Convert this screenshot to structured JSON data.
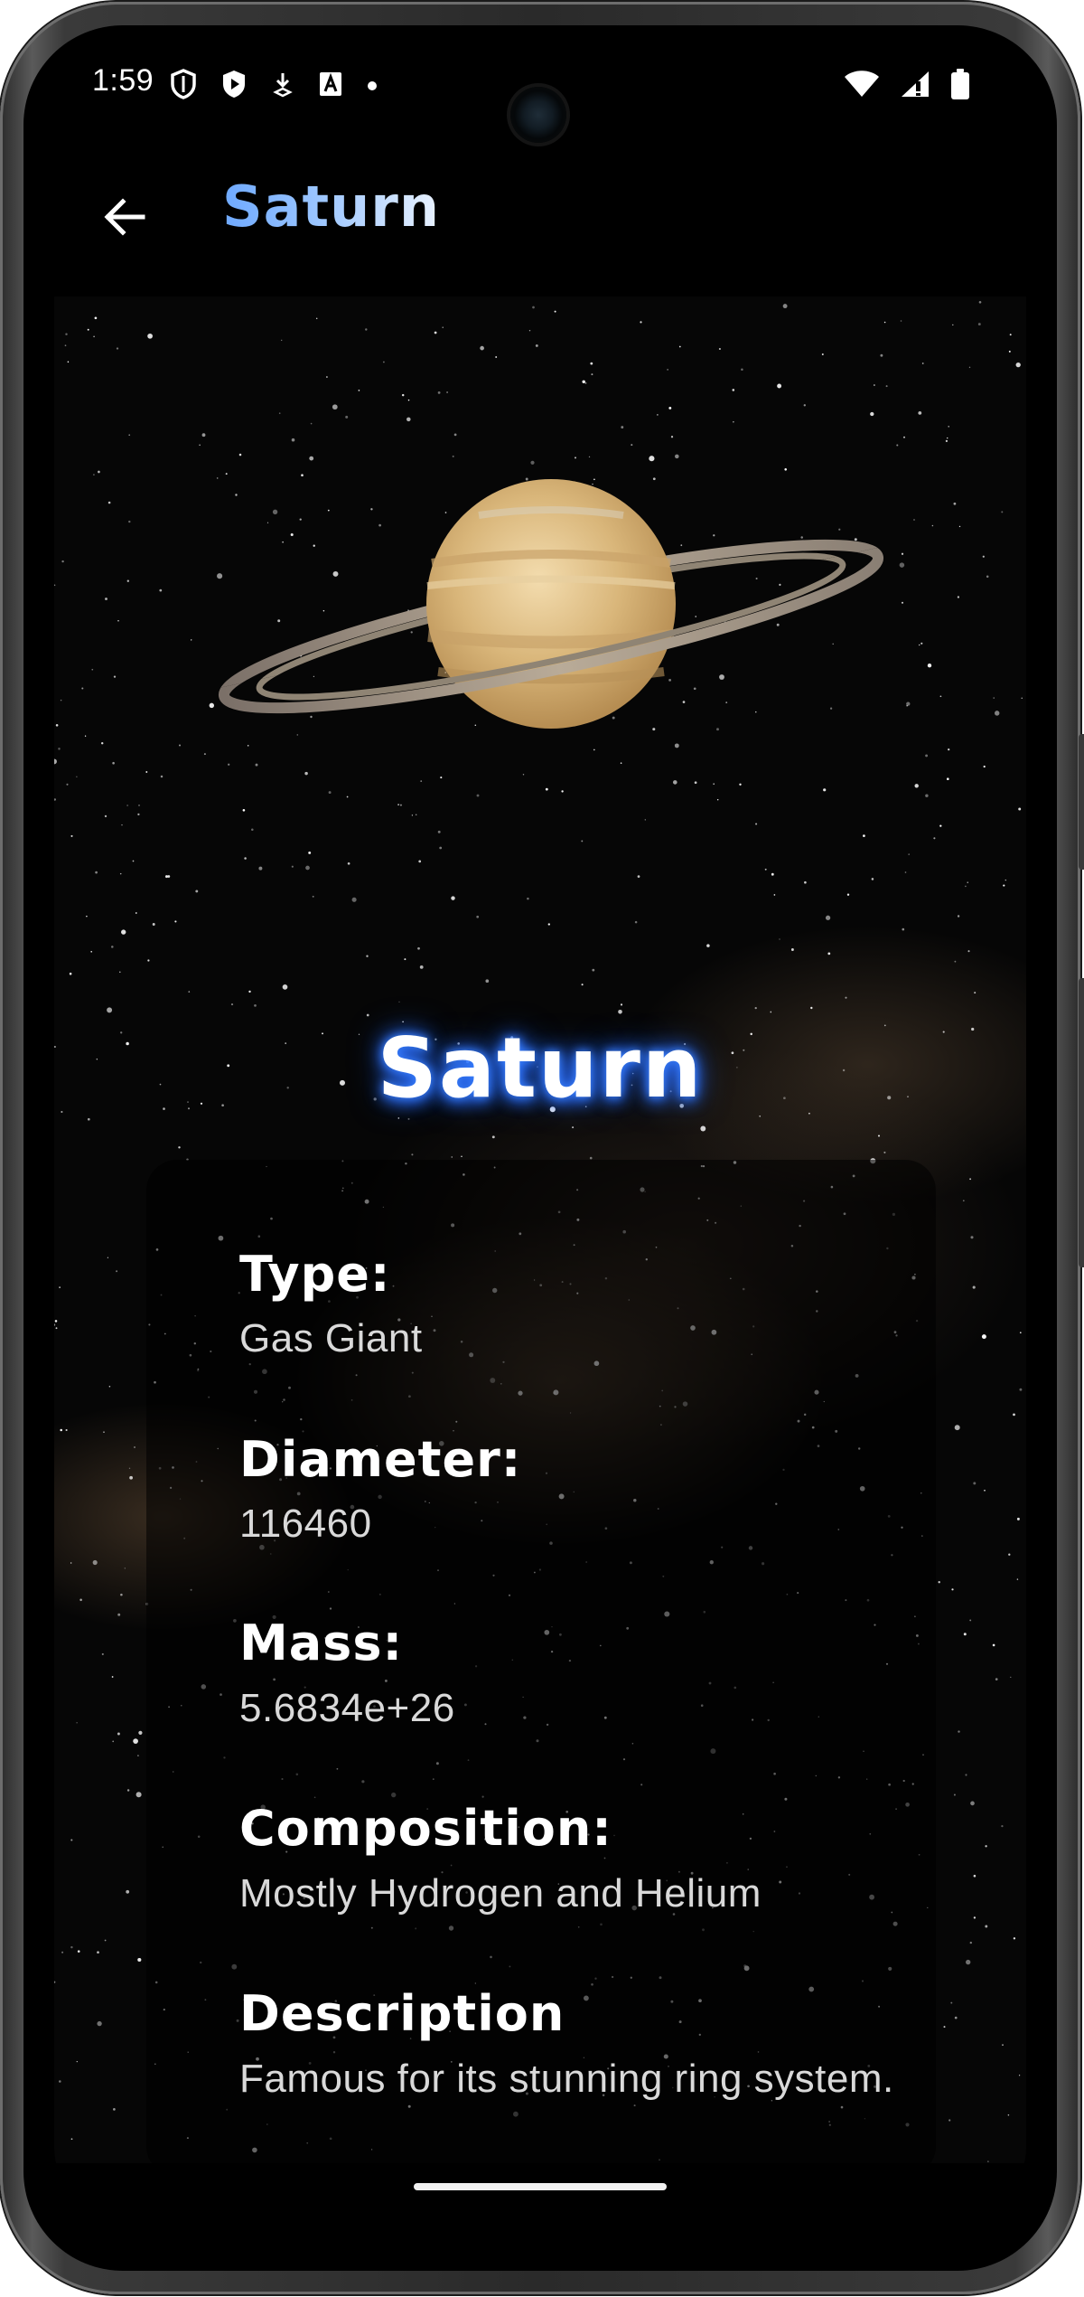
{
  "status_bar": {
    "time": "1:59",
    "left_icons": [
      "shield-icon",
      "play-protect-icon",
      "download-icon",
      "font-a-icon",
      "dot-icon"
    ],
    "right_icons": [
      "wifi-icon",
      "signal-icon",
      "battery-icon"
    ]
  },
  "app_bar": {
    "back_icon": "arrow-left-icon",
    "title": "Saturn"
  },
  "planet": {
    "name": "Saturn",
    "image": "saturn-illustration"
  },
  "details": [
    {
      "label": "Type:",
      "value": "Gas Giant"
    },
    {
      "label": "Diameter:",
      "value": "116460"
    },
    {
      "label": "Mass:",
      "value": "5.6834e+26"
    },
    {
      "label": "Composition:",
      "value": "Mostly Hydrogen and Helium"
    },
    {
      "label": "Description",
      "value": "Famous for its stunning ring system."
    }
  ],
  "colors": {
    "title_gradient_start": "#6ea9ff",
    "title_gradient_end": "#e9f2ff",
    "glow": "#3b82ff",
    "background": "#060606"
  }
}
